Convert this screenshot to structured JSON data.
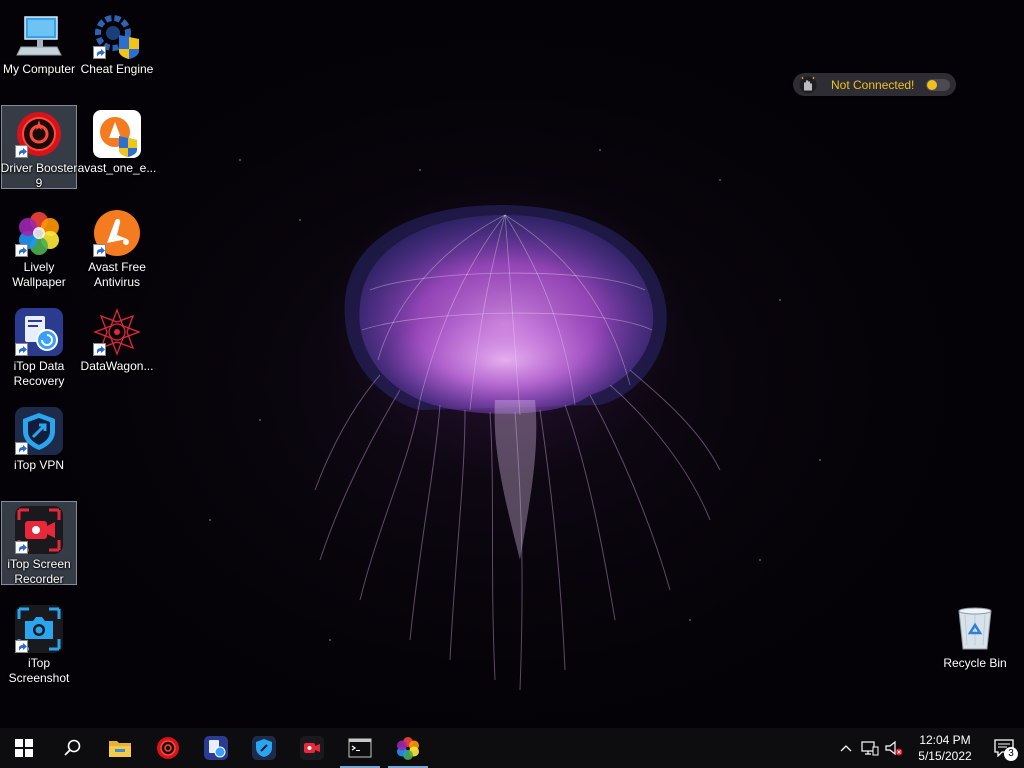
{
  "desktop": {
    "icons": [
      {
        "label": "My Computer"
      },
      {
        "label": "Cheat Engine"
      },
      {
        "label": "Driver Booster 9"
      },
      {
        "label": "avast_one_e..."
      },
      {
        "label": "Lively Wallpaper"
      },
      {
        "label": "Avast Free Antivirus"
      },
      {
        "label": "iTop Data Recovery"
      },
      {
        "label": "DataWagon..."
      },
      {
        "label": "iTop VPN"
      },
      {
        "label": "iTop Screen Recorder"
      },
      {
        "label": "iTop Screenshot"
      },
      {
        "label": "Recycle Bin"
      }
    ]
  },
  "widget": {
    "status_text": "Not Connected!",
    "accent": "#f0c020"
  },
  "taskbar": {
    "items": [
      {
        "icon": "windows-start-icon"
      },
      {
        "icon": "search-icon"
      },
      {
        "icon": "file-explorer-icon"
      },
      {
        "icon": "driver-booster-icon"
      },
      {
        "icon": "itop-data-recovery-icon"
      },
      {
        "icon": "itop-vpn-icon"
      },
      {
        "icon": "itop-screen-recorder-icon"
      },
      {
        "icon": "command-prompt-icon"
      },
      {
        "icon": "lively-wallpaper-icon"
      }
    ],
    "clock": {
      "time": "12:04 PM",
      "date": "5/15/2022"
    },
    "notification_count": "3"
  }
}
